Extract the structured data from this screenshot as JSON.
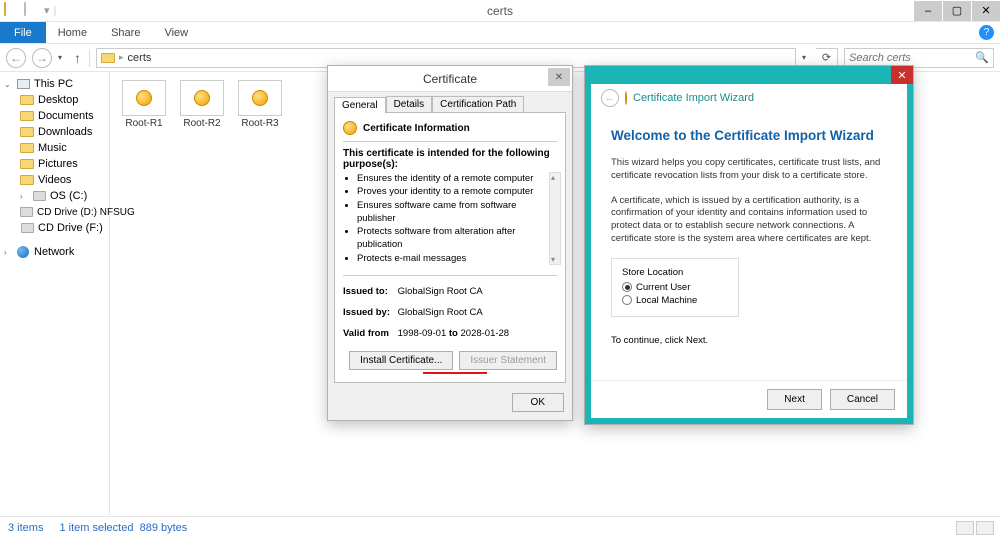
{
  "window": {
    "title": "certs"
  },
  "menu": {
    "file": "File",
    "home": "Home",
    "share": "Share",
    "view": "View"
  },
  "nav": {
    "folder": "certs",
    "search_placeholder": "Search certs",
    "chevron_down": "▾"
  },
  "sidebar": {
    "thispc": "This PC",
    "desktop": "Desktop",
    "documents": "Documents",
    "downloads": "Downloads",
    "music": "Music",
    "pictures": "Pictures",
    "videos": "Videos",
    "osdrive": "OS (C:)",
    "cddrive_d": "CD Drive (D:) NFSUG",
    "cddrive_f": "CD Drive (F:)",
    "network": "Network"
  },
  "files": [
    {
      "name": "Root-R1"
    },
    {
      "name": "Root-R2"
    },
    {
      "name": "Root-R3"
    }
  ],
  "status": {
    "items": "3 items",
    "selected": "1 item selected",
    "size": "889 bytes"
  },
  "cert_dialog": {
    "title": "Certificate",
    "tabs": {
      "general": "General",
      "details": "Details",
      "path": "Certification Path"
    },
    "info_heading": "Certificate Information",
    "intended_heading": "This certificate is intended for the following purpose(s):",
    "purposes": [
      "Ensures the identity of a remote computer",
      "Proves your identity to a remote computer",
      "Ensures software came from software publisher",
      "Protects software from alteration after publication",
      "Protects e-mail messages"
    ],
    "issued_to_label": "Issued to:",
    "issued_to": "GlobalSign Root CA",
    "issued_by_label": "Issued by:",
    "issued_by": "GlobalSign Root CA",
    "valid_label": "Valid from",
    "valid_from": "1998-09-01",
    "valid_to_word": "to",
    "valid_to": "2028-01-28",
    "install_btn": "Install Certificate...",
    "issuer_btn": "Issuer Statement",
    "ok_btn": "OK"
  },
  "wizard": {
    "header": "Certificate Import Wizard",
    "welcome": "Welcome to the Certificate Import Wizard",
    "p1": "This wizard helps you copy certificates, certificate trust lists, and certificate revocation lists from your disk to a certificate store.",
    "p2": "A certificate, which is issued by a certification authority, is a confirmation of your identity and contains information used to protect data or to establish secure network connections. A certificate store is the system area where certificates are kept.",
    "store_label": "Store Location",
    "radio_current": "Current User",
    "radio_machine": "Local Machine",
    "continue": "To continue, click Next.",
    "next": "Next",
    "cancel": "Cancel"
  }
}
